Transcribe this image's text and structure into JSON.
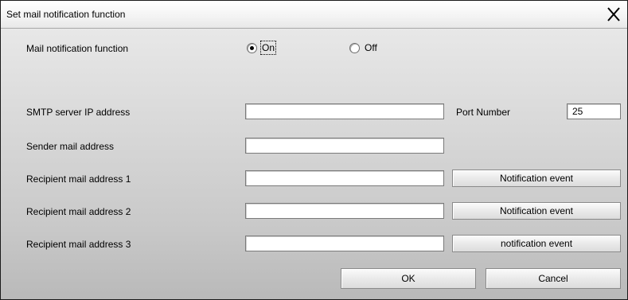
{
  "window": {
    "title": "Set mail notification function",
    "close_icon": "close-x-icon"
  },
  "mail_notification": {
    "label": "Mail notification function",
    "options": [
      "On",
      "Off"
    ],
    "selected": "On"
  },
  "smtp": {
    "label": "SMTP server IP address",
    "value": ""
  },
  "port": {
    "label": "Port Number",
    "value": "25"
  },
  "sender": {
    "label": "Sender mail address",
    "value": ""
  },
  "recipients": [
    {
      "label": "Recipient mail address 1",
      "value": "",
      "button": "Notification event"
    },
    {
      "label": "Recipient mail address 2",
      "value": "",
      "button": "Notification event"
    },
    {
      "label": "Recipient mail address 3",
      "value": "",
      "button": "notification event"
    }
  ],
  "footer": {
    "ok": "OK",
    "cancel": "Cancel"
  }
}
